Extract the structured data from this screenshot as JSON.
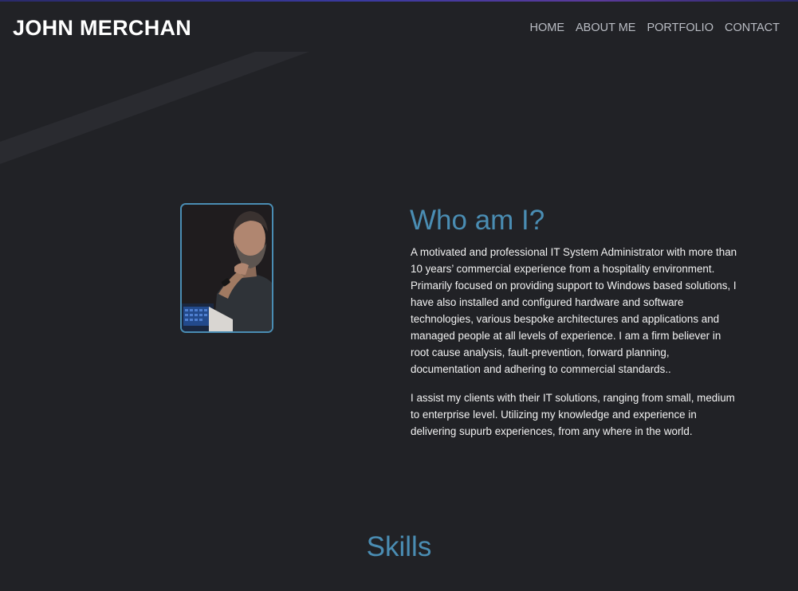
{
  "header": {
    "brand": "JOHN MERCHAN",
    "nav": [
      {
        "label": "HOME"
      },
      {
        "label": "ABOUT ME"
      },
      {
        "label": "PORTFOLIO"
      },
      {
        "label": "CONTACT"
      }
    ]
  },
  "about": {
    "title": "Who am I?",
    "paragraphs": [
      "A motivated and professional IT System Administrator with more than 10 years’ commercial experience from a hospitality environment. Primarily focused on providing support to Windows based solutions, I have also installed and configured hardware and software technologies, various bespoke architectures and applications and managed people at all levels of experience. I am a firm believer in root cause analysis, fault-prevention, forward planning, documentation and adhering to commercial standards..",
      "I assist my clients with their IT solutions, ranging from small, medium to enterprise level. Utilizing my knowledge and experience in delivering supurb experiences, from any where in the world."
    ]
  },
  "skills": {
    "title": "Skills"
  },
  "colors": {
    "background": "#212226",
    "accent": "#4a8db3",
    "nav_text": "#b9bcc3",
    "body_text": "#f2f2f2"
  },
  "icons": {
    "profile_photo": "profile-photo"
  }
}
